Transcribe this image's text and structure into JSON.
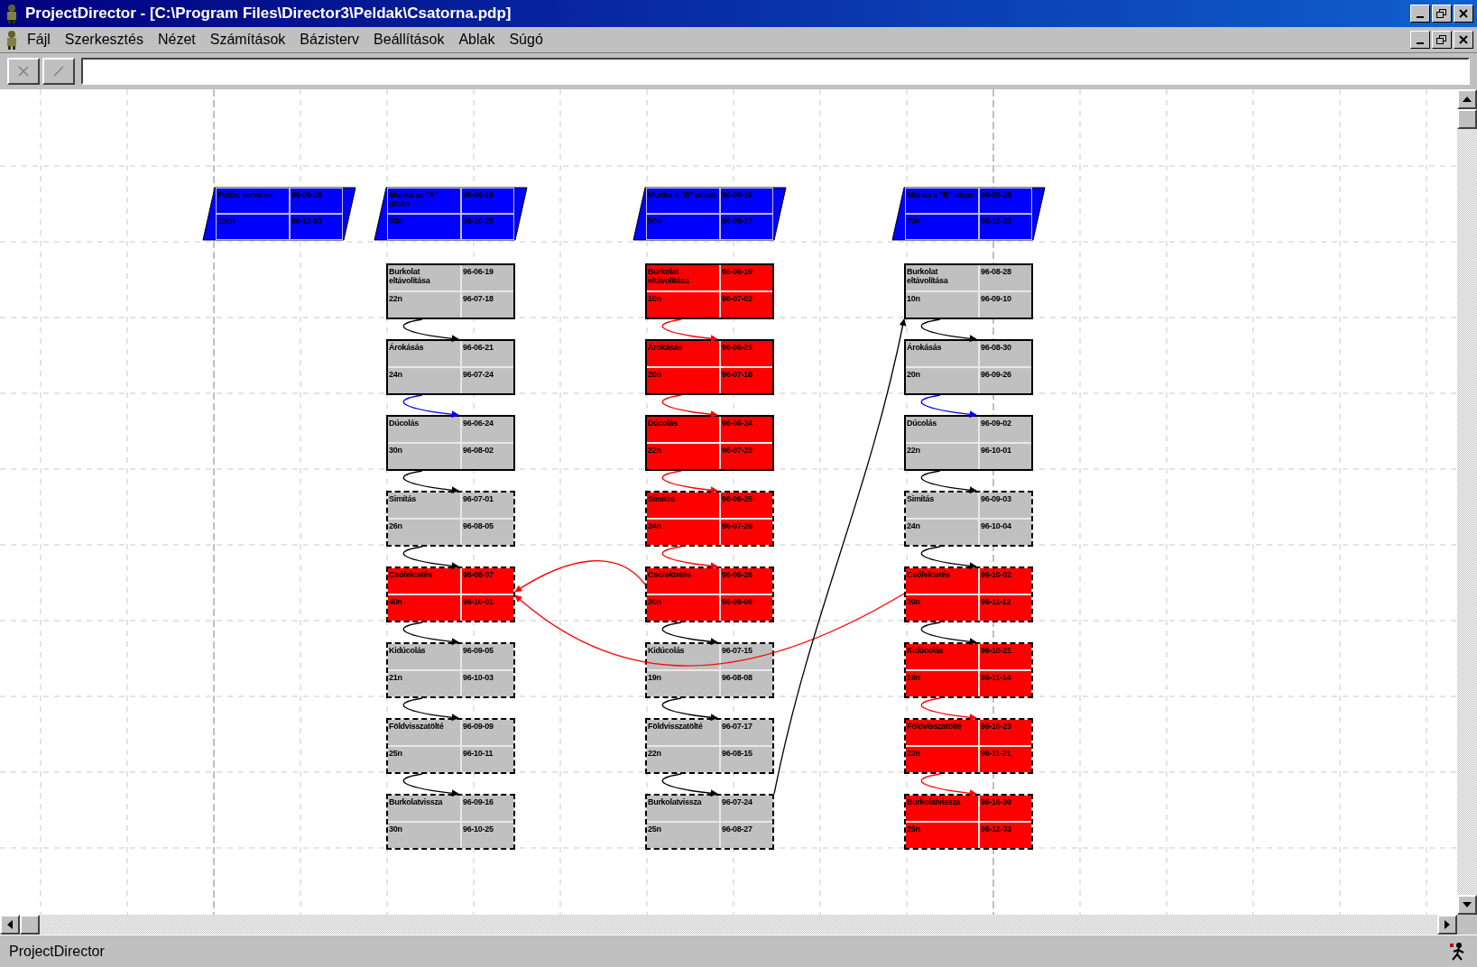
{
  "window": {
    "title": "ProjectDirector - [C:\\Program Files\\Director3\\Peldak\\Csatorna.pdp]"
  },
  "menu": [
    "Fájl",
    "Szerkesztés",
    "Nézet",
    "Számítások",
    "Bázisterv",
    "Beállítások",
    "Ablak",
    "Súgó"
  ],
  "diagram": {
    "project_summary": {
      "name": "Public services",
      "duration": "120n",
      "start": "96-06-19",
      "end": "96-12-03"
    },
    "columns": [
      {
        "summary": {
          "name": "Munka az \"A\" utcán",
          "duration": "93n",
          "start": "96-06-19",
          "end": "96-10-25"
        },
        "tasks": [
          {
            "name": "Burkolat eltávolítása",
            "duration": "22n",
            "start": "96-06-19",
            "end": "96-07-18",
            "critical": false,
            "dashed": false
          },
          {
            "name": "Árokásás",
            "duration": "24n",
            "start": "96-06-21",
            "end": "96-07-24",
            "critical": false,
            "dashed": false,
            "link": {
              "color": "#000000"
            }
          },
          {
            "name": "Dúcolás",
            "duration": "30n",
            "start": "96-06-24",
            "end": "96-08-02",
            "critical": false,
            "dashed": false,
            "link": {
              "color": "#0000ff"
            }
          },
          {
            "name": "Simítás",
            "duration": "26n",
            "start": "96-07-01",
            "end": "96-08-05",
            "critical": false,
            "dashed": true,
            "link": {
              "color": "#000000"
            }
          },
          {
            "name": "Csőfektetés",
            "duration": "40n",
            "start": "96-08-07",
            "end": "96-10-01",
            "critical": true,
            "dashed": true,
            "link": {
              "color": "#000000"
            },
            "cross_links": [
              {
                "kind": "same-row-next-column",
                "color": "#ff0000"
              },
              {
                "kind": "same-row-column-after-next",
                "color": "#ff0000"
              }
            ]
          },
          {
            "name": "Kidúcolás",
            "duration": "21n",
            "start": "96-09-05",
            "end": "96-10-03",
            "critical": false,
            "dashed": true,
            "link": {
              "color": "#000000"
            }
          },
          {
            "name": "Földvisszatölté",
            "duration": "25n",
            "start": "96-09-09",
            "end": "96-10-11",
            "critical": false,
            "dashed": true,
            "link": {
              "color": "#000000"
            }
          },
          {
            "name": "Burkolatvissza",
            "duration": "30n",
            "start": "96-09-16",
            "end": "96-10-25",
            "critical": false,
            "dashed": true,
            "link": {
              "color": "#000000"
            }
          }
        ]
      },
      {
        "summary": {
          "name": "Munka a \"B\" utcán",
          "duration": "50n",
          "start": "96-06-19",
          "end": "96-08-27"
        },
        "tasks": [
          {
            "name": "Burkolat eltávolítása",
            "duration": "10n",
            "start": "96-06-19",
            "end": "96-07-02",
            "critical": true,
            "dashed": false
          },
          {
            "name": "Árokásás",
            "duration": "20n",
            "start": "96-06-21",
            "end": "96-07-18",
            "critical": true,
            "dashed": false,
            "link": {
              "color": "#ff0000"
            }
          },
          {
            "name": "Dúcolás",
            "duration": "22n",
            "start": "96-06-24",
            "end": "96-07-23",
            "critical": true,
            "dashed": false,
            "link": {
              "color": "#ff0000"
            }
          },
          {
            "name": "Simítás",
            "duration": "24n",
            "start": "96-06-25",
            "end": "96-07-26",
            "critical": true,
            "dashed": true,
            "link": {
              "color": "#ff0000"
            }
          },
          {
            "name": "Csőfektetés",
            "duration": "30n",
            "start": "96-06-26",
            "end": "96-08-06",
            "critical": true,
            "dashed": true,
            "link": {
              "color": "#ff0000"
            }
          },
          {
            "name": "Kidúcolás",
            "duration": "19n",
            "start": "96-07-15",
            "end": "96-08-08",
            "critical": false,
            "dashed": true,
            "link": {
              "color": "#000000"
            }
          },
          {
            "name": "Földvisszatölté",
            "duration": "22n",
            "start": "96-07-17",
            "end": "96-08-15",
            "critical": false,
            "dashed": true,
            "link": {
              "color": "#000000"
            }
          },
          {
            "name": "Burkolatvissza",
            "duration": "25n",
            "start": "96-07-24",
            "end": "96-08-27",
            "critical": false,
            "dashed": true,
            "link": {
              "color": "#000000"
            }
          }
        ]
      },
      {
        "summary": {
          "name": "Munka a \"B\" utcán",
          "duration": "70n",
          "start": "96-08-28",
          "end": "96-12-03"
        },
        "tasks": [
          {
            "name": "Burkolat eltávolítása",
            "duration": "10n",
            "start": "96-08-28",
            "end": "96-09-10",
            "critical": false,
            "dashed": false,
            "cross_links": [
              {
                "kind": "last-row-previous-column",
                "color": "#000000"
              }
            ]
          },
          {
            "name": "Árokásás",
            "duration": "20n",
            "start": "96-08-30",
            "end": "96-09-26",
            "critical": false,
            "dashed": false,
            "link": {
              "color": "#000000"
            }
          },
          {
            "name": "Dúcolás",
            "duration": "22n",
            "start": "96-09-02",
            "end": "96-10-01",
            "critical": false,
            "dashed": false,
            "link": {
              "color": "#0000ff"
            }
          },
          {
            "name": "Simítás",
            "duration": "24n",
            "start": "96-09-03",
            "end": "96-10-04",
            "critical": false,
            "dashed": true,
            "link": {
              "color": "#000000"
            }
          },
          {
            "name": "Csőfektetés",
            "duration": "30n",
            "start": "96-10-02",
            "end": "96-11-12",
            "critical": true,
            "dashed": true,
            "link": {
              "color": "#000000"
            }
          },
          {
            "name": "Kidúcolás",
            "duration": "19n",
            "start": "96-10-21",
            "end": "96-11-14",
            "critical": true,
            "dashed": true,
            "link": {
              "color": "#000000"
            }
          },
          {
            "name": "Földvisszatölté",
            "duration": "22n",
            "start": "96-10-23",
            "end": "96-11-21",
            "critical": true,
            "dashed": true,
            "link": {
              "color": "#ff0000"
            }
          },
          {
            "name": "Burkolatvissza",
            "duration": "25n",
            "start": "96-10-30",
            "end": "96-12-03",
            "critical": true,
            "dashed": true,
            "link": {
              "color": "#ff0000"
            }
          }
        ]
      }
    ]
  },
  "status_bar": {
    "text": "ProjectDirector"
  }
}
